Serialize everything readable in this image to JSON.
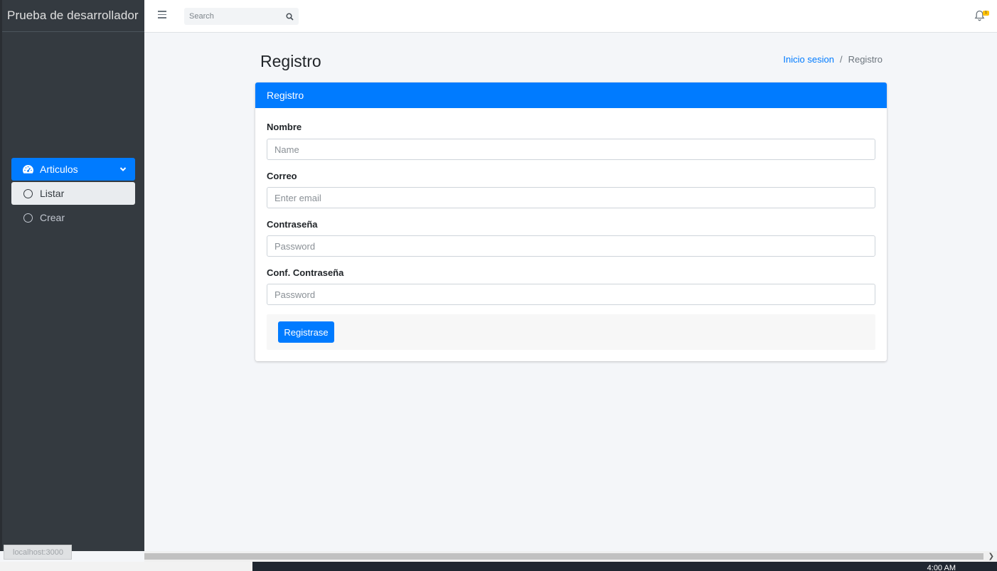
{
  "sidebar": {
    "brand": "Prueba de desarrollador",
    "menu": {
      "parent_label": "Articulos",
      "items": [
        {
          "label": "Listar",
          "active": true
        },
        {
          "label": "Crear",
          "active": false
        }
      ]
    }
  },
  "navbar": {
    "search_placeholder": "Search",
    "notification_count": "1"
  },
  "content": {
    "title": "Registro",
    "breadcrumb": {
      "link": "Inicio sesion",
      "current": "Registro"
    }
  },
  "card": {
    "header": "Registro",
    "fields": [
      {
        "label": "Nombre",
        "placeholder": "Name",
        "value": ""
      },
      {
        "label": "Correo",
        "placeholder": "Enter email",
        "value": ""
      },
      {
        "label": "Contraseña",
        "placeholder": "Password",
        "value": ""
      },
      {
        "label": "Conf. Contraseña",
        "placeholder": "Password",
        "value": ""
      }
    ],
    "submit_label": "Registrase"
  },
  "status_bar": {
    "url": "localhost:3000"
  },
  "taskbar": {
    "time": "4:00 AM"
  },
  "colors": {
    "primary": "#007bff",
    "sidebar_bg": "#343a40",
    "content_bg": "#f4f6f9",
    "badge": "#ffc107"
  }
}
